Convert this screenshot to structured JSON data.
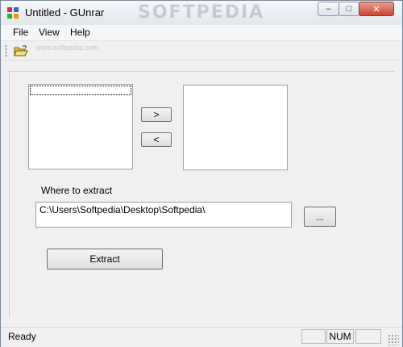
{
  "window": {
    "title": "Untitled - GUnrar"
  },
  "watermark": {
    "large": "SOFTPEDIA",
    "small": "www.softpedia.com"
  },
  "titlebar_buttons": {
    "minimize": "–",
    "maximize": "□",
    "close": "✕"
  },
  "menu": {
    "items": [
      "File",
      "View",
      "Help"
    ]
  },
  "toolbar": {
    "open_icon": "open-folder-icon"
  },
  "main": {
    "add_button_label": ">",
    "remove_button_label": "<",
    "where_label": "Where to extract",
    "path_value": "C:\\Users\\Softpedia\\Desktop\\Softpedia\\",
    "browse_button_label": "...",
    "extract_button_label": "Extract"
  },
  "status": {
    "text": "Ready",
    "num_indicator": "NUM"
  },
  "colors": {
    "close_button": "#c9452f",
    "list_background": "#ffffff",
    "window_background": "#f0f0f0"
  }
}
